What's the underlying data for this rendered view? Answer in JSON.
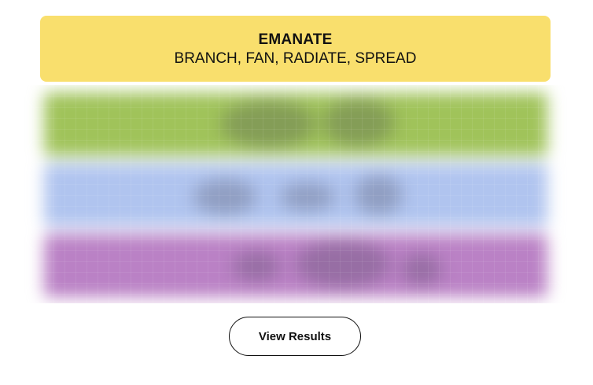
{
  "solved_group": {
    "title": "EMANATE",
    "members": "BRANCH, FAN, RADIATE, SPREAD",
    "color": "#f9df6d"
  },
  "hidden_rows": [
    {
      "color": "#a0c35a",
      "state": "blurred"
    },
    {
      "color": "#b0c4ef",
      "state": "blurred"
    },
    {
      "color": "#ba81c5",
      "state": "blurred"
    }
  ],
  "results_button": {
    "label": "View Results"
  }
}
